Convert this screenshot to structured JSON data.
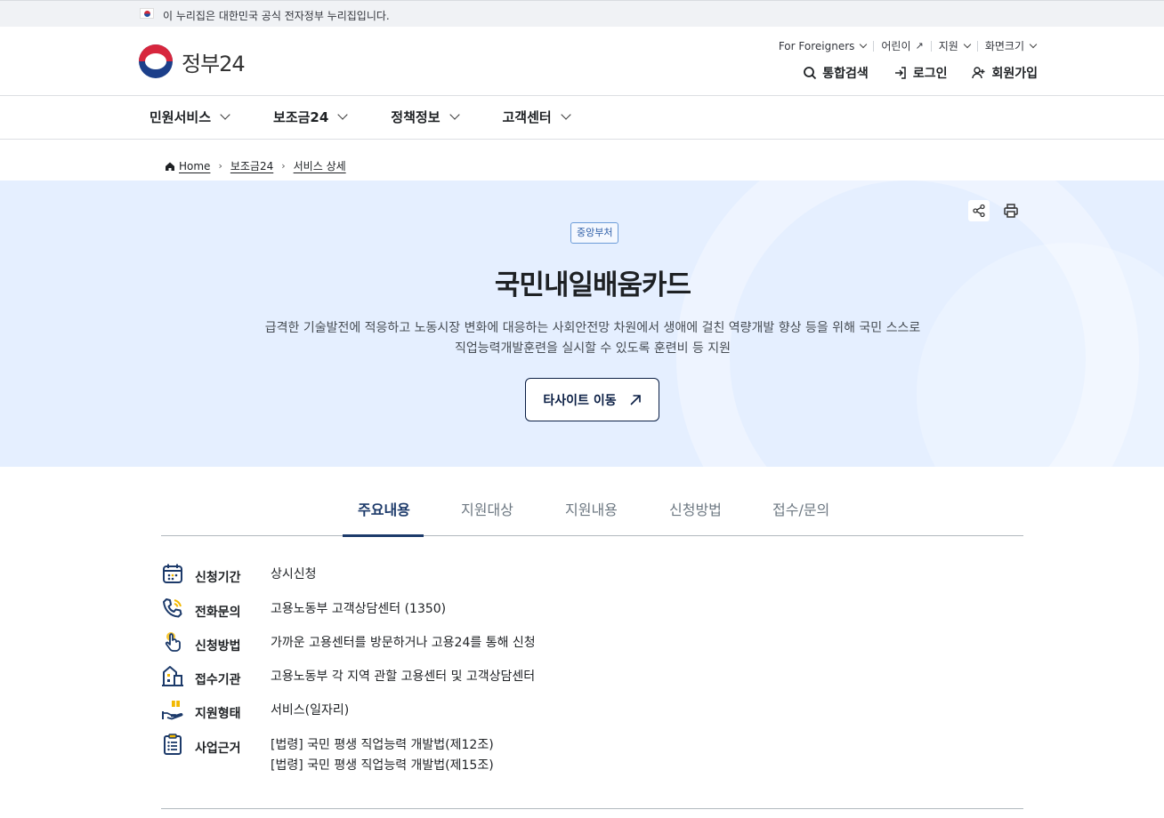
{
  "topbar": {
    "notice": "이 누리집은 대한민국 공식 전자정부 누리집입니다."
  },
  "header": {
    "logo_text": "정부24",
    "util": [
      {
        "label": "For Foreigners"
      },
      {
        "label": "어린이"
      },
      {
        "label": "지원"
      },
      {
        "label": "화면크기"
      }
    ],
    "actions": {
      "search": "통합검색",
      "login": "로그인",
      "signup": "회원가입"
    }
  },
  "gnb": [
    "민원서비스",
    "보조금24",
    "정책정보",
    "고객센터"
  ],
  "breadcrumb": [
    "Home",
    "보조금24",
    "서비스 상세"
  ],
  "hero": {
    "badge": "중앙부처",
    "title": "국민내일배움카드",
    "desc_line1": "급격한 기술발전에 적응하고 노동시장 변화에 대응하는 사회안전망 차원에서 생애에 걸친 역량개발 향상 등을 위해 국민 스스로",
    "desc_line2": "직업능력개발훈련을 실시할 수 있도록 훈련비 등 지원",
    "button": "타사이트 이동"
  },
  "tabs": [
    "주요내용",
    "지원대상",
    "지원내용",
    "신청방법",
    "접수/문의"
  ],
  "info": [
    {
      "icon": "calendar-icon",
      "label": "신청기간",
      "value": "상시신청"
    },
    {
      "icon": "phone-icon",
      "label": "전화문의",
      "value": "고용노동부 고객상담센터 (1350)"
    },
    {
      "icon": "hand-pointer-icon",
      "label": "신청방법",
      "value": "가까운 고용센터를 방문하거나 고용24를 통해 신청"
    },
    {
      "icon": "building-icon",
      "label": "접수기관",
      "value": "고용노동부 각 지역 관할 고용센터 및 고객상담센터"
    },
    {
      "icon": "hand-gift-icon",
      "label": "지원형태",
      "value": "서비스(일자리)"
    },
    {
      "icon": "clipboard-icon",
      "label": "사업근거",
      "value": "[법령] 국민 평생 직업능력 개발법(제12조)",
      "value2": "[법령] 국민 평생 직업능력 개발법(제15조)"
    }
  ]
}
